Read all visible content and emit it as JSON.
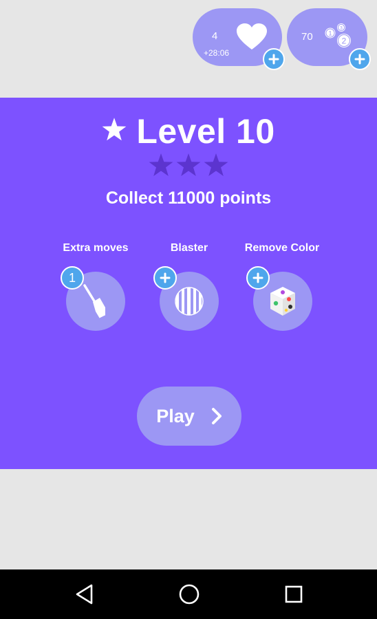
{
  "status": {
    "lives": {
      "count": "4",
      "timer": "+28:06"
    },
    "coins": {
      "count": "70",
      "badges": [
        "1",
        "3",
        "2"
      ]
    }
  },
  "level": {
    "title": "Level 10",
    "stars_earned": 0,
    "stars_total": 3,
    "goal": "Collect 11000 points"
  },
  "boosters": [
    {
      "label": "Extra moves",
      "badge": "1",
      "icon": "hammer-icon"
    },
    {
      "label": "Blaster",
      "badge": "+",
      "icon": "striped-ball-icon"
    },
    {
      "label": "Remove Color",
      "badge": "+",
      "icon": "dice-icon"
    }
  ],
  "play": {
    "label": "Play"
  },
  "colors": {
    "panel": "#7d52ff",
    "bubble": "#9c97f4",
    "plus": "#4fa6ec",
    "star_empty": "#5c34cf"
  }
}
